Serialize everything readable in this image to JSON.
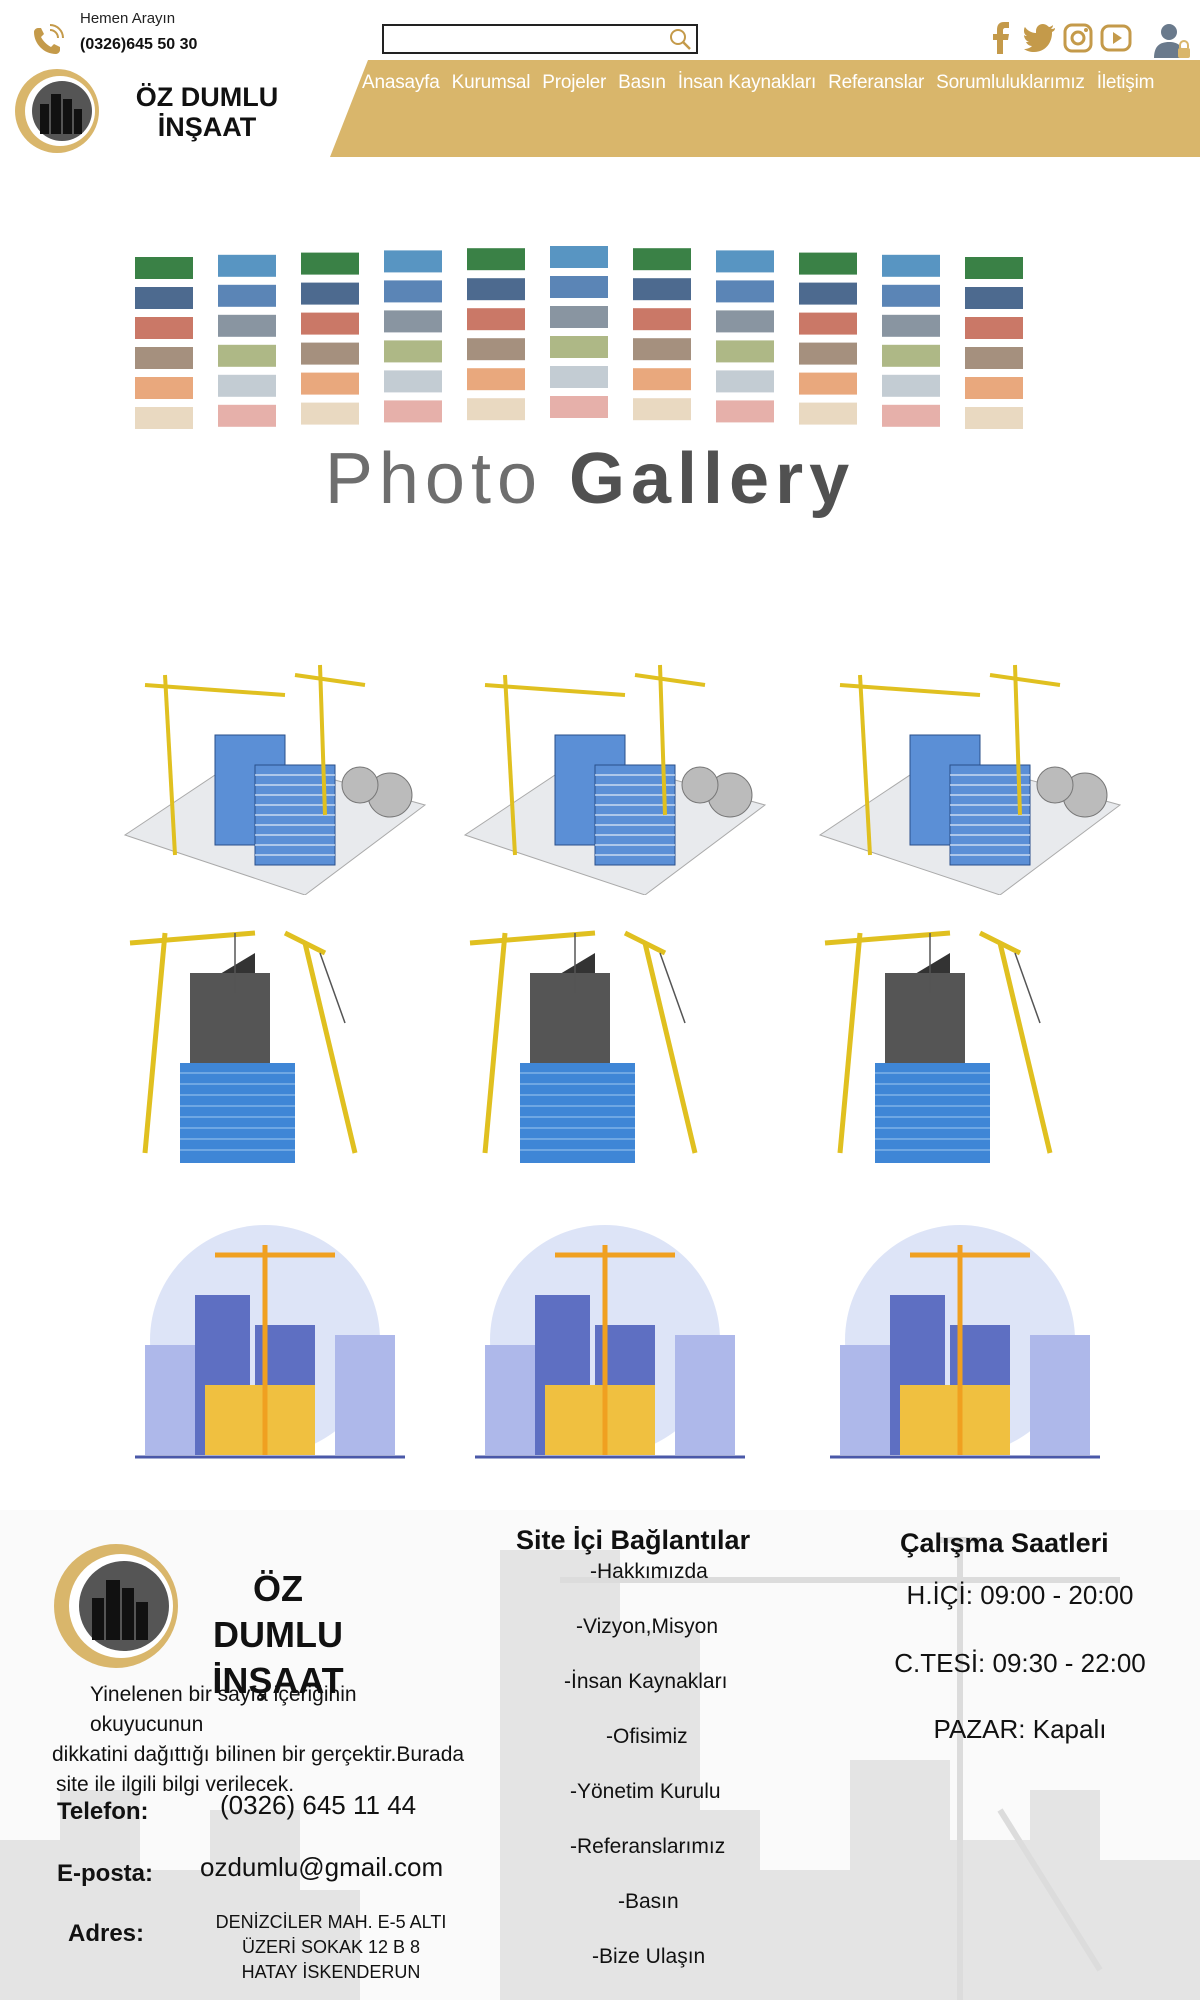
{
  "header": {
    "call_label": "Hemen Arayın",
    "call_number": "(0326)645 50 30",
    "search_placeholder": "",
    "logo_line1": "ÖZ DUMLU",
    "logo_line2": "İNŞAAT",
    "socials": [
      "facebook-icon",
      "twitter-icon",
      "instagram-icon",
      "youtube-icon"
    ]
  },
  "nav": {
    "items": [
      {
        "label": "Anasayfa"
      },
      {
        "label": "Kurumsal"
      },
      {
        "label": "Projeler"
      },
      {
        "label": "Basın"
      },
      {
        "label": "İnsan Kaynakları"
      },
      {
        "label": "Referanslar"
      },
      {
        "label": "Sorumluluklarımız"
      },
      {
        "label": "İletişim"
      }
    ]
  },
  "banner": {
    "title_part1": "Photo",
    "title_part2": "Gallery"
  },
  "footer": {
    "logo_line1": "ÖZ DUMLU",
    "logo_line2": "İNŞAAT",
    "description": [
      "Yinelenen bir sayfa içeriğinin okuyucunun",
      "dikkatini dağıttığı bilinen bir gerçektir.Burada",
      "site ile ilgili  bilgi verilecek."
    ],
    "phone_label": "Telefon:",
    "phone_value": "(0326) 645 11 44",
    "email_label": "E-posta:",
    "email_value": "ozdumlu@gmail.com",
    "address_label": "Adres:",
    "address_lines": [
      "DENİZCİLER MAH. E-5 ALTI",
      "ÜZERİ SOKAK 12 B 8",
      "HATAY İSKENDERUN"
    ],
    "links_title": "Site İçi Bağlantılar",
    "links": [
      "-Hakkımızda",
      "-Vizyon,Misyon",
      "-İnsan Kaynakları",
      "-Ofisimiz",
      "-Yönetim Kurulu",
      "-Referanslarımız",
      "-Basın",
      "-Bize Ulaşın"
    ],
    "hours_title": "Çalışma Saatleri",
    "hours": [
      "H.İÇİ: 09:00 - 20:00",
      "C.TESİ: 09:30 - 22:00",
      "PAZAR: Kapalı"
    ]
  },
  "colors": {
    "accent": "#d9b66b",
    "nav_text": "#ffffff",
    "social": "#c49a4a"
  }
}
